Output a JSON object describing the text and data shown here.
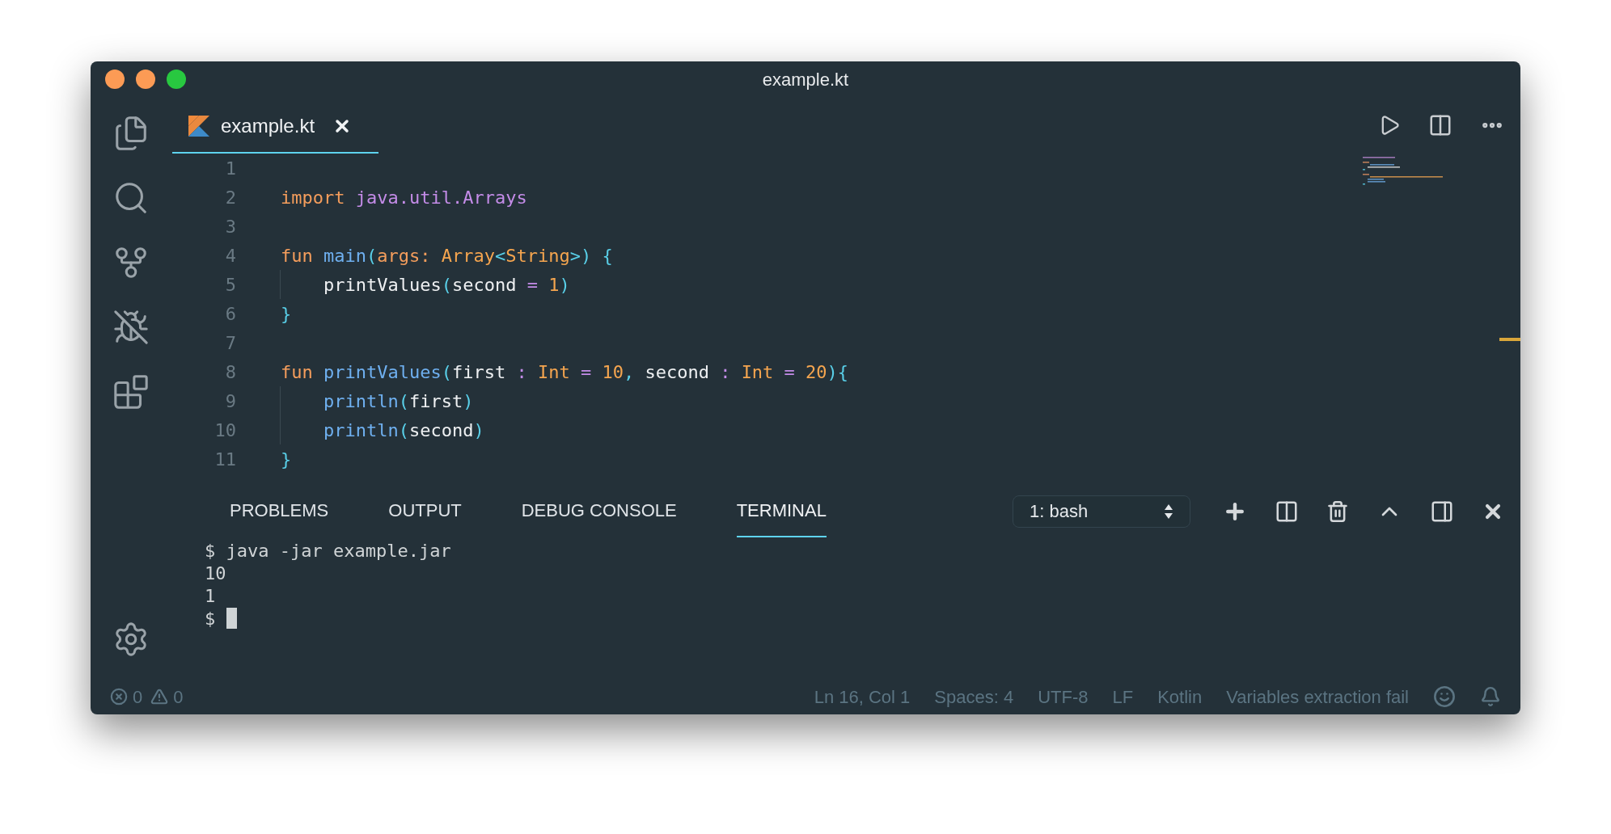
{
  "window": {
    "title": "example.kt"
  },
  "activity_bar": [
    {
      "kind": "files"
    },
    {
      "kind": "search"
    },
    {
      "kind": "source-control"
    },
    {
      "kind": "debug"
    },
    {
      "kind": "extensions"
    }
  ],
  "settings": {
    "kind": "settings"
  },
  "tabs": [
    {
      "label": "example.kt",
      "selected": true
    }
  ],
  "code": [
    {
      "number": "1"
    },
    {
      "number": "2",
      "tokens": [
        {
          "kind": "kw",
          "t": "import "
        },
        {
          "kind": "pkg",
          "t": "java.util.Arrays"
        }
      ]
    },
    {
      "number": "3"
    },
    {
      "number": "4",
      "tokens": [
        {
          "kind": "kw",
          "t": "fun "
        },
        {
          "kind": "fn",
          "t": "main"
        },
        {
          "kind": "punct",
          "t": "("
        },
        {
          "kind": "kw",
          "t": "args: "
        },
        {
          "kind": "type",
          "t": "Array"
        },
        {
          "kind": "punct",
          "t": "<"
        },
        {
          "kind": "type",
          "t": "String"
        },
        {
          "kind": "punct",
          "t": ">) {"
        }
      ]
    },
    {
      "number": "5",
      "guide": true,
      "tokens": [
        {
          "kind": "plain",
          "t": "    printValues"
        },
        {
          "kind": "punct",
          "t": "("
        },
        {
          "kind": "plain",
          "t": "second "
        },
        {
          "kind": "op",
          "t": "= "
        },
        {
          "kind": "num",
          "t": "1"
        },
        {
          "kind": "punct",
          "t": ")"
        }
      ]
    },
    {
      "number": "6",
      "tokens": [
        {
          "kind": "punct",
          "t": "}"
        }
      ]
    },
    {
      "number": "7"
    },
    {
      "number": "8",
      "tokens": [
        {
          "kind": "kw",
          "t": "fun "
        },
        {
          "kind": "fn",
          "t": "printValues"
        },
        {
          "kind": "punct",
          "t": "("
        },
        {
          "kind": "plain",
          "t": "first "
        },
        {
          "kind": "op",
          "t": ": "
        },
        {
          "kind": "type",
          "t": "Int "
        },
        {
          "kind": "op",
          "t": "= "
        },
        {
          "kind": "num",
          "t": "10"
        },
        {
          "kind": "punct",
          "t": ", "
        },
        {
          "kind": "plain",
          "t": "second "
        },
        {
          "kind": "op",
          "t": ": "
        },
        {
          "kind": "type",
          "t": "Int "
        },
        {
          "kind": "op",
          "t": "= "
        },
        {
          "kind": "num",
          "t": "20"
        },
        {
          "kind": "punct",
          "t": "){"
        }
      ]
    },
    {
      "number": "9",
      "guide": true,
      "tokens": [
        {
          "kind": "fn",
          "t": "    println"
        },
        {
          "kind": "punct",
          "t": "("
        },
        {
          "kind": "plain",
          "t": "first"
        },
        {
          "kind": "punct",
          "t": ")"
        }
      ]
    },
    {
      "number": "10",
      "guide": true,
      "tokens": [
        {
          "kind": "fn",
          "t": "    println"
        },
        {
          "kind": "punct",
          "t": "("
        },
        {
          "kind": "plain",
          "t": "second"
        },
        {
          "kind": "punct",
          "t": ")"
        }
      ]
    },
    {
      "number": "11",
      "tokens": [
        {
          "kind": "punct",
          "t": "}"
        }
      ]
    }
  ],
  "panel": {
    "tabs": [
      {
        "label": "PROBLEMS",
        "selected": false
      },
      {
        "label": "OUTPUT",
        "selected": false
      },
      {
        "label": "DEBUG CONSOLE",
        "selected": false
      },
      {
        "label": "TERMINAL",
        "selected": true
      }
    ],
    "terminal_select": "1: bash",
    "terminal": [
      "$ java -jar example.jar",
      "10",
      "1",
      "$"
    ],
    "cursor": true
  },
  "status_bar": {
    "errors": "0",
    "warnings": "0",
    "items": [
      "Ln 16, Col 1",
      "Spaces: 4",
      "UTF-8",
      "LF",
      "Kotlin",
      "Variables extraction fail"
    ]
  }
}
